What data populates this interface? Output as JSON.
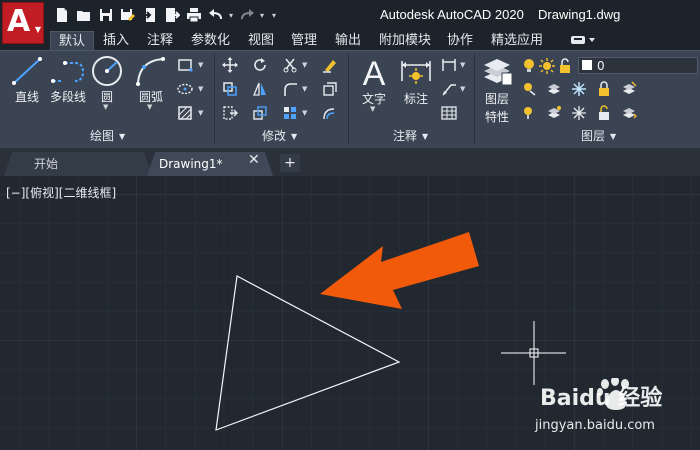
{
  "window": {
    "app_title": "Autodesk AutoCAD 2020",
    "file_name": "Drawing1.dwg"
  },
  "app_button": {
    "glyph": "A",
    "icon": "autocad-logo-icon",
    "color": "#c01e24"
  },
  "quick_access": [
    {
      "icon": "new-icon"
    },
    {
      "icon": "open-icon"
    },
    {
      "icon": "save-icon"
    },
    {
      "icon": "save-as-icon"
    },
    {
      "icon": "web-open-icon"
    },
    {
      "icon": "web-save-icon"
    },
    {
      "icon": "print-icon"
    },
    {
      "icon": "undo-icon"
    },
    {
      "icon": "redo-icon"
    },
    {
      "icon": "customize-dropdown-icon"
    }
  ],
  "ribbon_tabs": [
    {
      "label": "默认",
      "active": true
    },
    {
      "label": "插入"
    },
    {
      "label": "注释"
    },
    {
      "label": "参数化"
    },
    {
      "label": "视图"
    },
    {
      "label": "管理"
    },
    {
      "label": "输出"
    },
    {
      "label": "附加模块"
    },
    {
      "label": "协作"
    },
    {
      "label": "精选应用"
    }
  ],
  "ribbon": {
    "draw": {
      "title": "绘图",
      "tools": [
        {
          "label": "直线",
          "icon": "line-icon"
        },
        {
          "label": "多段线",
          "icon": "polyline-icon"
        },
        {
          "label": "圆",
          "icon": "circle-icon"
        },
        {
          "label": "圆弧",
          "icon": "arc-icon"
        }
      ],
      "small_tools": [
        {
          "icon": "rectangle-icon"
        },
        {
          "icon": "ellipse-icon"
        },
        {
          "icon": "hatch-icon"
        }
      ]
    },
    "modify": {
      "title": "修改",
      "small_tools": [
        {
          "icon": "move-icon"
        },
        {
          "icon": "rotate-icon"
        },
        {
          "icon": "trim-icon"
        },
        {
          "icon": "erase-icon"
        },
        {
          "icon": "copy-icon"
        },
        {
          "icon": "mirror-icon"
        },
        {
          "icon": "fillet-icon"
        },
        {
          "icon": "explode-icon"
        },
        {
          "icon": "stretch-icon"
        },
        {
          "icon": "scale-icon"
        },
        {
          "icon": "array-icon"
        },
        {
          "icon": "offset-icon"
        }
      ]
    },
    "annotation": {
      "title": "注释",
      "tools": [
        {
          "label": "文字",
          "icon": "text-icon"
        },
        {
          "label": "标注",
          "icon": "dimension-icon"
        }
      ],
      "small_tools": [
        {
          "icon": "linear-dim-icon"
        },
        {
          "icon": "leader-icon"
        },
        {
          "icon": "table-icon"
        }
      ]
    },
    "layers": {
      "title": "图层",
      "tool_label_1": "图层",
      "tool_label_2": "特性",
      "current_layer": "0",
      "accent": "#f2c12e"
    }
  },
  "doc_tabs": [
    {
      "label": "开始"
    },
    {
      "label": "Drawing1*",
      "active": true
    }
  ],
  "doc_tab_close": "✕",
  "doc_tab_add": "+",
  "viewport": {
    "label": "[−][俯视][二维线框]"
  },
  "annotation_arrow": {
    "color": "#f05a0a"
  },
  "watermark": {
    "main": "Baidu 经验",
    "sub": "jingyan.baidu.com"
  }
}
